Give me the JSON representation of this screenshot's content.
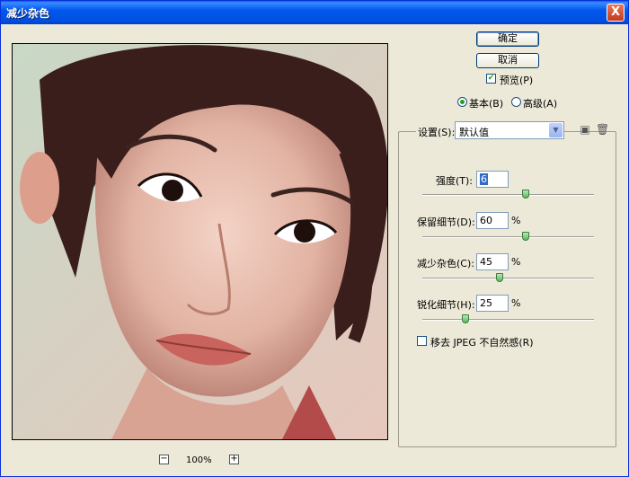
{
  "window": {
    "title": "减少杂色",
    "close_label": "X"
  },
  "buttons": {
    "ok": "确定",
    "cancel": "取消"
  },
  "preview": {
    "label": "预览(P)",
    "checked": true
  },
  "mode": {
    "basic": "基本(B)",
    "advanced": "高级(A)",
    "selected": "basic"
  },
  "settings": {
    "label": "设置(S):",
    "value": "默认值"
  },
  "controls": [
    {
      "label": "强度(T):",
      "value": "6",
      "unit": "",
      "slider": 0.6
    },
    {
      "label": "保留细节(D):",
      "value": "60",
      "unit": "%",
      "slider": 0.6
    },
    {
      "label": "减少杂色(C):",
      "value": "45",
      "unit": "%",
      "slider": 0.45
    },
    {
      "label": "锐化细节(H):",
      "value": "25",
      "unit": "%",
      "slider": 0.25
    }
  ],
  "jpeg": {
    "label": "移去 JPEG 不自然感(R)",
    "checked": false
  },
  "zoom": {
    "minus": "−",
    "plus": "+",
    "level": "100%"
  },
  "icons": {
    "save": "save-settings-icon",
    "delete": "trash-icon"
  }
}
